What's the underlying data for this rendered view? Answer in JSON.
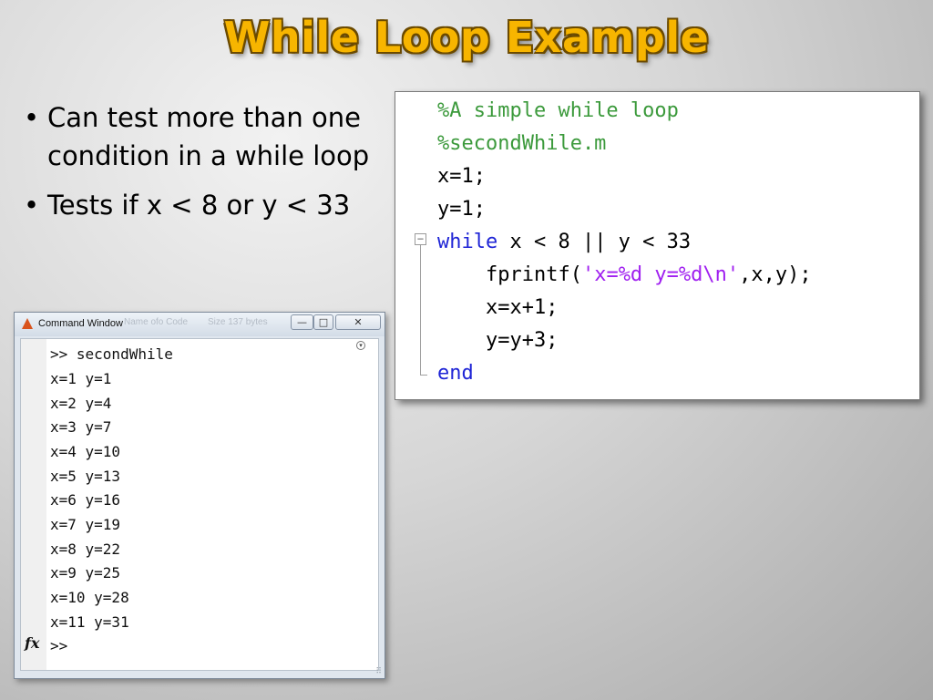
{
  "slide": {
    "title": "While Loop Example",
    "bullets": [
      "Can test more than one condition in a while loop",
      "Tests if x < 8 or y < 33"
    ]
  },
  "code": {
    "comment1": "%A simple while loop",
    "comment2": "%secondWhile.m",
    "line_x": "x=1;",
    "line_y": "y=1;",
    "while_kw": "while",
    "while_cond": " x < 8 || y < 33",
    "fprintf_pre": "    fprintf(",
    "fprintf_str": "'x=%d y=%d\\n'",
    "fprintf_post": ",x,y);",
    "inc_x": "    x=x+1;",
    "inc_y": "    y=y+3;",
    "end_kw": "end",
    "fold_symbol": "−",
    "colors": {
      "comment": "#3c9a3c",
      "keyword": "#1f25d6",
      "string": "#a020f0"
    }
  },
  "command_window": {
    "title": "Command Window",
    "ghost_left": "Name  ofo Code",
    "ghost_right": "Size  137 bytes",
    "buttons": {
      "minimize": "—",
      "maximize": "□",
      "close": "✕"
    },
    "lines": [
      ">> secondWhile",
      "x=1 y=1",
      "x=2 y=4",
      "x=3 y=7",
      "x=4 y=10",
      "x=5 y=13",
      "x=6 y=16",
      "x=7 y=19",
      "x=8 y=22",
      "x=9 y=25",
      "x=10 y=28",
      "x=11 y=31",
      ">>"
    ],
    "fx_label": "fx",
    "scroll_symbol": "▾",
    "grip_symbol": "⠿",
    "icon": "matlab-logo-icon"
  }
}
